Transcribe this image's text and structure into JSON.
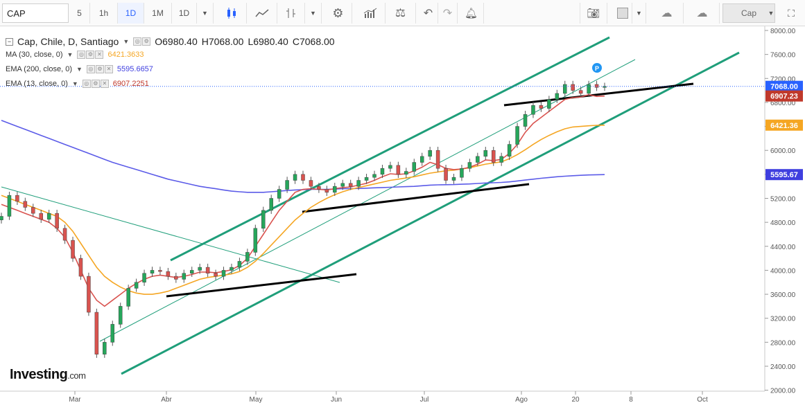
{
  "toolbar": {
    "symbol": "CAP",
    "intervals": [
      "5",
      "1h",
      "1D",
      "1M",
      "1D"
    ],
    "active_interval_index": 2,
    "right_label": "Cap",
    "icons": [
      "candles-icon",
      "indicators-icon",
      "bar-type-icon",
      "settings-icon",
      "study-icon",
      "compare-icon",
      "undo-icon",
      "redo-icon",
      "alert-icon",
      "camera-icon",
      "color-box-icon",
      "cloud-download-icon",
      "cloud-upload-icon",
      "fullscreen-icon"
    ]
  },
  "legend": {
    "title": "Cap, Chile, D, Santiago",
    "open": "O6980.40",
    "high": "H7068.00",
    "low": "L6980.40",
    "close": "C7068.00",
    "ma30": {
      "label": "MA (30, close, 0)",
      "value": "6421.3633",
      "color": "#f5a623"
    },
    "ema200": {
      "label": "EMA (200, close, 0)",
      "value": "5595.6657",
      "color": "#3f3fdf"
    },
    "ema13": {
      "label": "EMA (13, close, 0)",
      "value": "6907.2251",
      "color": "#c0392b"
    }
  },
  "watermark": {
    "brand": "Investing",
    "suffix": ".com"
  },
  "chart_data": {
    "type": "line",
    "y_ticks": [
      "8000.00",
      "7600.00",
      "7200.00",
      "6800.00",
      "6400.00",
      "6000.00",
      "5600.00",
      "5200.00",
      "4800.00",
      "4400.00",
      "4000.00",
      "3600.00",
      "3200.00",
      "2800.00",
      "2400.00",
      "2000.00"
    ],
    "x_ticks": [
      "Mar",
      "Abr",
      "May",
      "Jun",
      "Jul",
      "Ago",
      "20",
      "8",
      "Oct"
    ],
    "ylim": [
      2000,
      8200
    ],
    "price_labels": [
      {
        "text": "7068.00",
        "value": 7068,
        "color": "#2962ff"
      },
      {
        "text": "6907.23",
        "value": 6907,
        "color": "#c0392b"
      },
      {
        "text": "6421.36",
        "value": 6421,
        "color": "#f5a623"
      },
      {
        "text": "5595.67",
        "value": 5596,
        "color": "#3f3fdf"
      }
    ],
    "close_series": [
      4900,
      5250,
      5150,
      5050,
      4950,
      4850,
      4950,
      4700,
      4500,
      4200,
      3900,
      3300,
      2600,
      2800,
      3100,
      3400,
      3700,
      3800,
      3950,
      4000,
      3980,
      3900,
      3850,
      3950,
      4000,
      4050,
      3950,
      3900,
      4000,
      4050,
      4150,
      4300,
      4700,
      5000,
      5200,
      5350,
      5500,
      5600,
      5500,
      5400,
      5350,
      5300,
      5400,
      5450,
      5400,
      5500,
      5550,
      5600,
      5700,
      5750,
      5600,
      5650,
      5800,
      5900,
      6000,
      5700,
      5500,
      5550,
      5700,
      5800,
      5900,
      6000,
      5800,
      5900,
      6100,
      6400,
      6600,
      6750,
      6700,
      6850,
      6950,
      7100,
      7000,
      6950,
      7100,
      7050,
      7068
    ],
    "ema13": [
      5100,
      5050,
      5000,
      4950,
      4900,
      4850,
      4800,
      4700,
      4550,
      4300,
      4000,
      3700,
      3500,
      3400,
      3500,
      3600,
      3700,
      3780,
      3850,
      3900,
      3920,
      3900,
      3880,
      3900,
      3930,
      3970,
      3970,
      3960,
      3980,
      4010,
      4080,
      4200,
      4400,
      4600,
      4800,
      5000,
      5150,
      5300,
      5350,
      5360,
      5350,
      5340,
      5360,
      5380,
      5390,
      5420,
      5450,
      5500,
      5560,
      5610,
      5600,
      5610,
      5660,
      5720,
      5800,
      5760,
      5700,
      5680,
      5690,
      5720,
      5770,
      5840,
      5830,
      5850,
      5950,
      6100,
      6300,
      6450,
      6550,
      6650,
      6750,
      6850,
      6880,
      6890,
      6930,
      6900,
      6907
    ],
    "ma30": [
      5250,
      5200,
      5150,
      5100,
      5050,
      5000,
      4950,
      4900,
      4800,
      4650,
      4450,
      4250,
      4050,
      3900,
      3800,
      3720,
      3660,
      3620,
      3600,
      3600,
      3620,
      3650,
      3700,
      3750,
      3800,
      3850,
      3880,
      3900,
      3920,
      3940,
      3980,
      4050,
      4150,
      4280,
      4420,
      4560,
      4700,
      4840,
      4950,
      5050,
      5130,
      5200,
      5260,
      5310,
      5350,
      5380,
      5410,
      5440,
      5470,
      5500,
      5520,
      5540,
      5560,
      5590,
      5620,
      5640,
      5660,
      5670,
      5690,
      5710,
      5740,
      5770,
      5790,
      5810,
      5860,
      5930,
      6010,
      6100,
      6180,
      6250,
      6310,
      6360,
      6390,
      6400,
      6410,
      6418,
      6421
    ],
    "ema200": [
      6500,
      6450,
      6400,
      6350,
      6300,
      6250,
      6200,
      6150,
      6100,
      6050,
      6000,
      5950,
      5900,
      5850,
      5800,
      5760,
      5720,
      5680,
      5640,
      5600,
      5560,
      5520,
      5490,
      5460,
      5430,
      5400,
      5380,
      5360,
      5340,
      5320,
      5310,
      5300,
      5300,
      5300,
      5310,
      5320,
      5330,
      5340,
      5345,
      5350,
      5350,
      5350,
      5355,
      5360,
      5362,
      5365,
      5370,
      5375,
      5380,
      5385,
      5390,
      5395,
      5400,
      5410,
      5420,
      5425,
      5428,
      5430,
      5435,
      5440,
      5448,
      5456,
      5460,
      5465,
      5475,
      5490,
      5505,
      5520,
      5535,
      5548,
      5560,
      5570,
      5578,
      5585,
      5590,
      5594,
      5596
    ],
    "trendlines": "channel, support and resistance lines",
    "grid": false
  }
}
